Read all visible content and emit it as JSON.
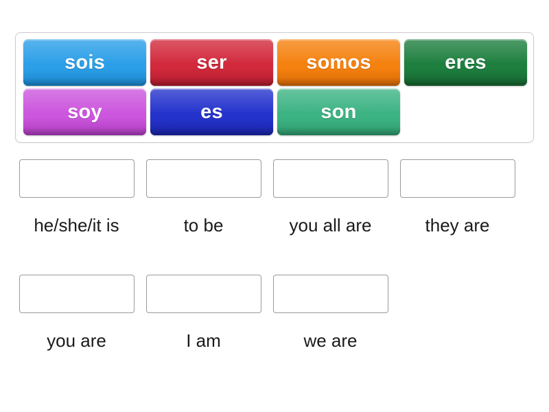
{
  "activity": {
    "type": "match-up-drag-and-drop",
    "word_bank": {
      "rows": [
        [
          {
            "label": "sois",
            "color": "#2b9fe8",
            "color_dark": "#1b86cc"
          },
          {
            "label": "ser",
            "color": "#d2293c",
            "color_dark": "#b01b2c"
          },
          {
            "label": "somos",
            "color": "#f5810f",
            "color_dark": "#d86a06"
          },
          {
            "label": "eres",
            "color": "#1e7f3f",
            "color_dark": "#156530"
          }
        ],
        [
          {
            "label": "soy",
            "color": "#cc56dd",
            "color_dark": "#ad3cbd"
          },
          {
            "label": "es",
            "color": "#2433cc",
            "color_dark": "#1a24a8"
          },
          {
            "label": "son",
            "color": "#3cb383",
            "color_dark": "#2e9a6d"
          }
        ]
      ]
    },
    "answers": {
      "rows": [
        [
          {
            "label": "he/she/it is",
            "placed": ""
          },
          {
            "label": "to be",
            "placed": ""
          },
          {
            "label": "you all are",
            "placed": ""
          },
          {
            "label": "they are",
            "placed": ""
          }
        ],
        [
          {
            "label": "you are",
            "placed": ""
          },
          {
            "label": "I am",
            "placed": ""
          },
          {
            "label": "we are",
            "placed": ""
          }
        ]
      ]
    }
  }
}
